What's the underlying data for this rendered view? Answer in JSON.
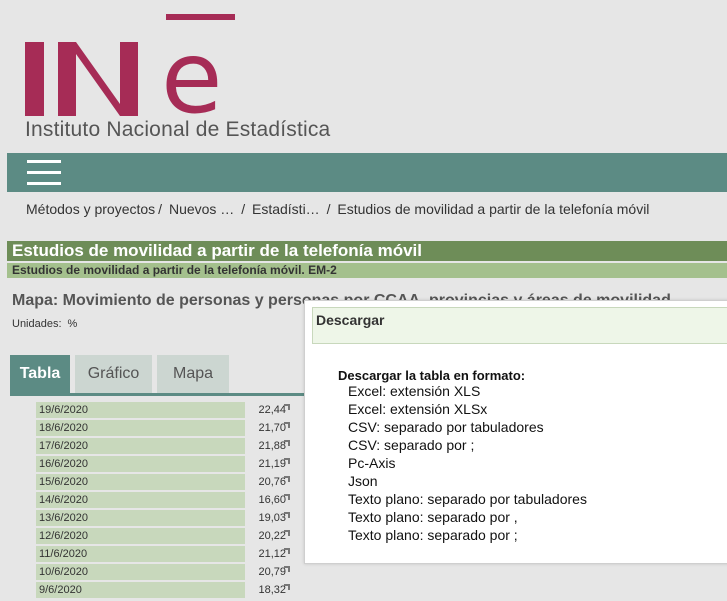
{
  "site_name": "Instituto Nacional de Estadística",
  "breadcrumb": [
    {
      "label": "Métodos y proyectos"
    },
    {
      "label": "Nuevos …"
    },
    {
      "label": "Estadísti…"
    },
    {
      "label": "Estudios de movilidad a partir de la telefonía móvil"
    }
  ],
  "page_title": "Estudios de movilidad a partir de la telefonía móvil",
  "page_subtitle": "Estudios de movilidad a partir de la telefonía móvil. EM-2",
  "map_title": "Mapa: Movimiento de personas y personas por CCAA, provincias y áreas de movilidad",
  "units_label": "Unidades:",
  "units_value": "%",
  "tabs": [
    "Tabla",
    "Gráfico",
    "Mapa"
  ],
  "table_rows": [
    {
      "date": "19/6/2020",
      "value": "22,44"
    },
    {
      "date": "18/6/2020",
      "value": "21,70"
    },
    {
      "date": "17/6/2020",
      "value": "21,88"
    },
    {
      "date": "16/6/2020",
      "value": "21,19"
    },
    {
      "date": "15/6/2020",
      "value": "20,76"
    },
    {
      "date": "14/6/2020",
      "value": "16,60"
    },
    {
      "date": "13/6/2020",
      "value": "19,03"
    },
    {
      "date": "12/6/2020",
      "value": "20,22"
    },
    {
      "date": "11/6/2020",
      "value": "21,12"
    },
    {
      "date": "10/6/2020",
      "value": "20,79"
    },
    {
      "date": "9/6/2020",
      "value": "18,32"
    }
  ],
  "popup": {
    "header": "Descargar",
    "lead": "Descargar la tabla en formato:",
    "formats": [
      "Excel: extensión XLS",
      "Excel: extensión XLSx",
      "CSV: separado por tabuladores",
      "CSV: separado por ;",
      "Pc-Axis",
      "Json",
      "Texto plano: separado por tabuladores",
      "Texto plano: separado por ,",
      "Texto plano: separado por ;"
    ]
  },
  "colors": {
    "brand": "#a62c56",
    "nav": "#5c8b84",
    "title_bar": "#6e8d58",
    "subtitle_bar": "#a4c08d"
  }
}
